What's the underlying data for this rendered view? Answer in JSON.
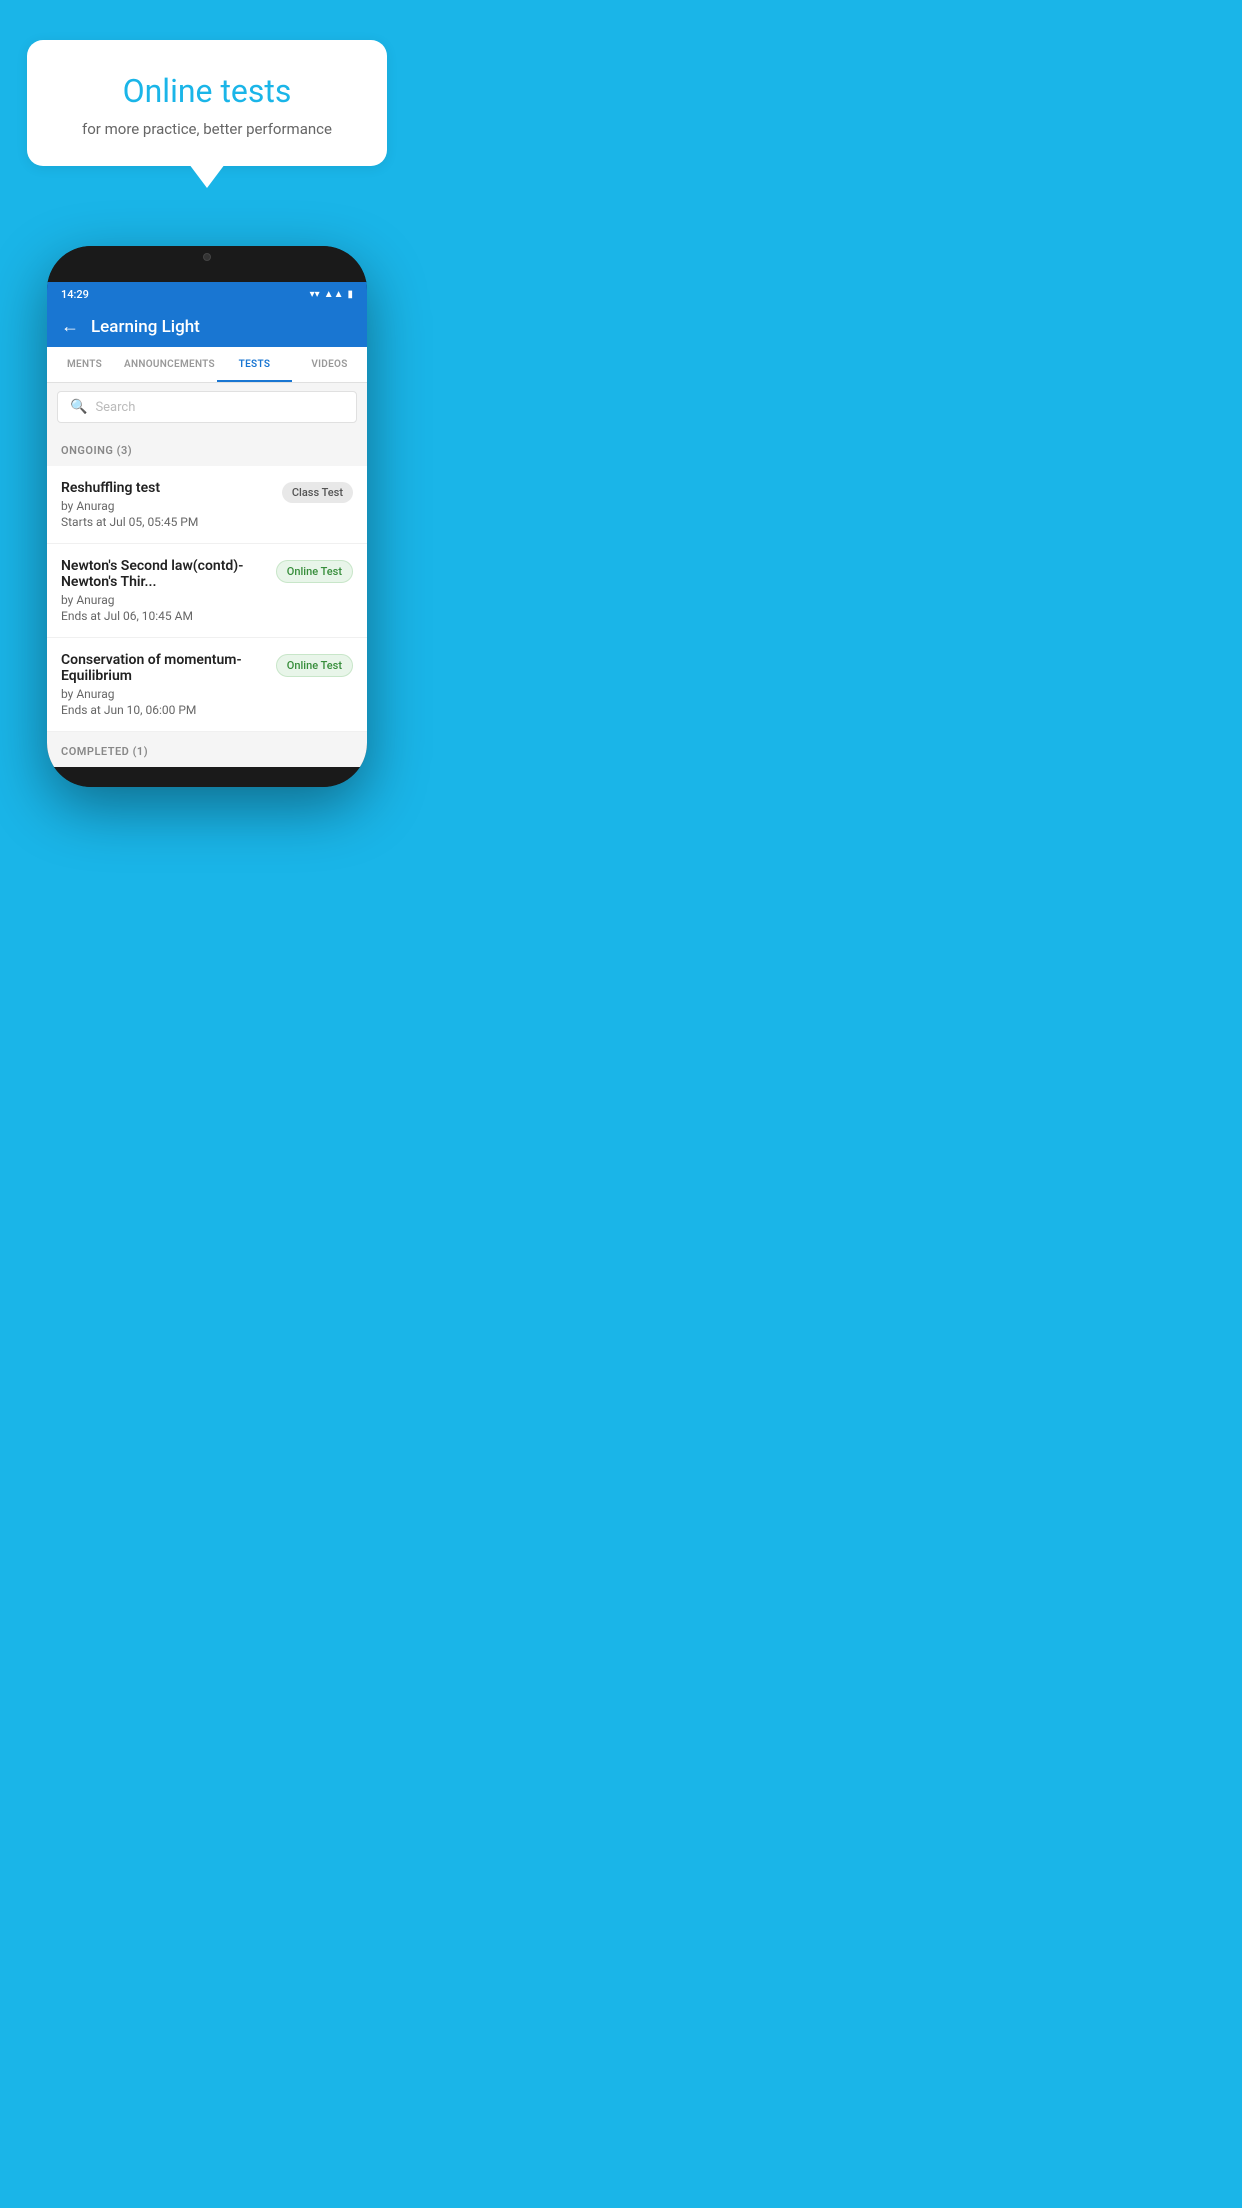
{
  "background_color": "#1ab5e8",
  "speech_bubble": {
    "title": "Online tests",
    "subtitle": "for more practice, better performance"
  },
  "phone": {
    "status_bar": {
      "time": "14:29",
      "icons": [
        "wifi",
        "signal",
        "battery"
      ]
    },
    "header": {
      "title": "Learning Light",
      "back_label": "←"
    },
    "tabs": [
      {
        "label": "MENTS",
        "active": false
      },
      {
        "label": "ANNOUNCEMENTS",
        "active": false
      },
      {
        "label": "TESTS",
        "active": true
      },
      {
        "label": "VIDEOS",
        "active": false
      }
    ],
    "search": {
      "placeholder": "Search"
    },
    "ongoing_section": {
      "label": "ONGOING (3)"
    },
    "test_items": [
      {
        "name": "Reshuffling test",
        "by": "by Anurag",
        "date_label": "Starts at",
        "date": "Jul 05, 05:45 PM",
        "badge": "Class Test",
        "badge_type": "class"
      },
      {
        "name": "Newton's Second law(contd)-Newton's Thir...",
        "by": "by Anurag",
        "date_label": "Ends at",
        "date": "Jul 06, 10:45 AM",
        "badge": "Online Test",
        "badge_type": "online"
      },
      {
        "name": "Conservation of momentum-Equilibrium",
        "by": "by Anurag",
        "date_label": "Ends at",
        "date": "Jun 10, 06:00 PM",
        "badge": "Online Test",
        "badge_type": "online"
      }
    ],
    "completed_section": {
      "label": "COMPLETED (1)"
    }
  }
}
